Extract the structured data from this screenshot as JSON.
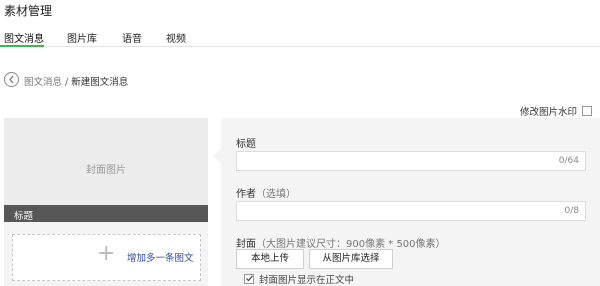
{
  "app": {
    "title": "素材管理"
  },
  "tabs": [
    {
      "label": "图文消息",
      "active": true
    },
    {
      "label": "图片库",
      "active": false
    },
    {
      "label": "语音",
      "active": false
    },
    {
      "label": "视频",
      "active": false
    }
  ],
  "breadcrumb": {
    "parent": "图文消息",
    "separator": "/",
    "current": "新建图文消息"
  },
  "watermark": {
    "label": "修改图片水印",
    "checked": false
  },
  "preview": {
    "cover_text": "封面图片",
    "title_bar": "标题",
    "add_label": "增加多一条图文",
    "add_icon": "plus-icon"
  },
  "form": {
    "title": {
      "label": "标题",
      "counter": "0/64"
    },
    "author": {
      "label": "作者",
      "hint": "（选填）",
      "counter": "0/8"
    },
    "cover": {
      "label": "封面",
      "hint": "（大图片建议尺寸：900像素 * 500像素）",
      "upload_button": "本地上传",
      "library_button": "从图片库选择",
      "show_in_body_label": "封面图片显示在正文中",
      "show_in_body_checked": true
    }
  },
  "colors": {
    "accent": "#44b549",
    "link": "#2b4ba8",
    "title_bar": "#575757"
  }
}
